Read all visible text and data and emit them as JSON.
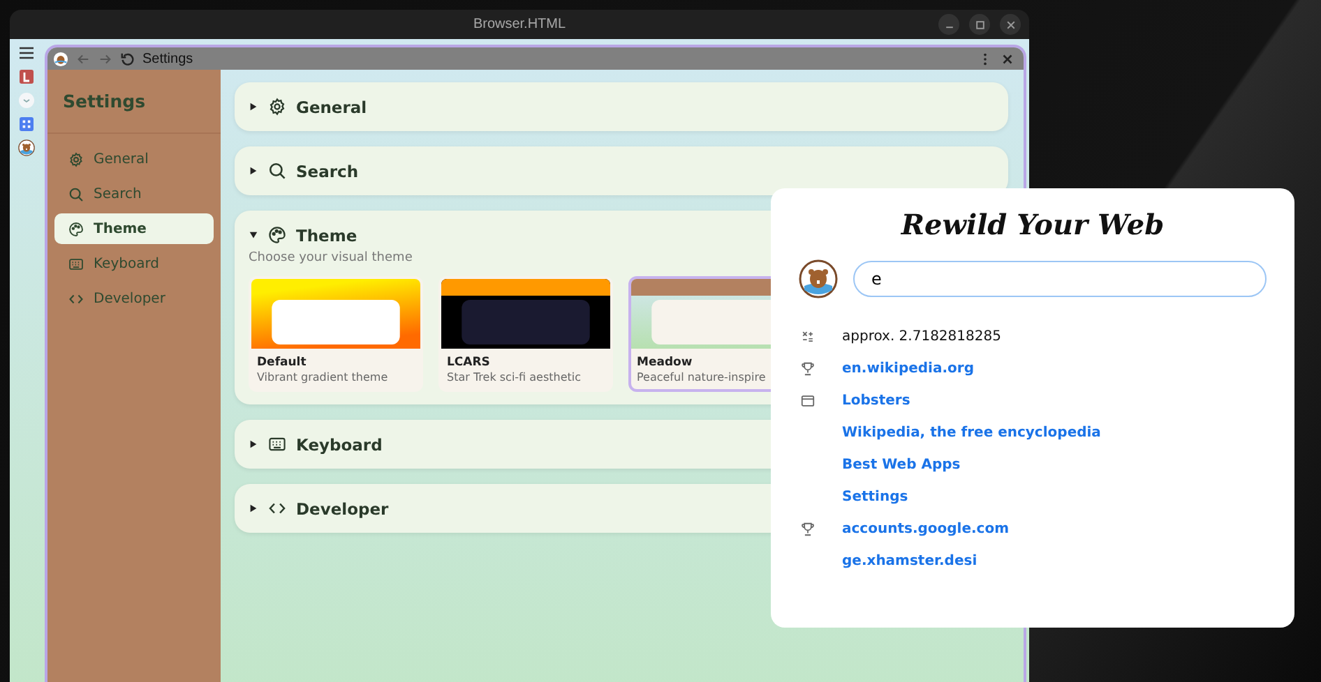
{
  "window": {
    "title": "Browser.HTML"
  },
  "tab": {
    "title": "Settings"
  },
  "sidebar": {
    "title": "Settings",
    "items": [
      {
        "label": "General",
        "selected": false
      },
      {
        "label": "Search",
        "selected": false
      },
      {
        "label": "Theme",
        "selected": true
      },
      {
        "label": "Keyboard",
        "selected": false
      },
      {
        "label": "Developer",
        "selected": false
      }
    ]
  },
  "sections": [
    {
      "title": "General",
      "expanded": false
    },
    {
      "title": "Search",
      "expanded": false
    },
    {
      "title": "Theme",
      "expanded": true,
      "subtitle": "Choose your visual theme",
      "themes": [
        {
          "name": "Default",
          "description": "Vibrant gradient theme",
          "selected": false
        },
        {
          "name": "LCARS",
          "description": "Star Trek sci-fi aesthetic",
          "selected": false
        },
        {
          "name": "Meadow",
          "description": "Peaceful nature-inspire",
          "selected": true
        }
      ]
    },
    {
      "title": "Keyboard",
      "expanded": false
    },
    {
      "title": "Developer",
      "expanded": false
    }
  ],
  "popup": {
    "title": "Rewild Your Web",
    "search_value": "e",
    "results": [
      {
        "text": "approx. 2.7182818285",
        "kind": "answer"
      },
      {
        "text": "en.wikipedia.org",
        "kind": "link"
      },
      {
        "text": "Lobsters",
        "kind": "link"
      },
      {
        "text": "Wikipedia, the free encyclopedia",
        "kind": "link"
      },
      {
        "text": "Best Web Apps",
        "kind": "link"
      },
      {
        "text": "Settings",
        "kind": "link"
      },
      {
        "text": "accounts.google.com",
        "kind": "link"
      },
      {
        "text": "ge.xhamster.desi",
        "kind": "link"
      }
    ]
  }
}
